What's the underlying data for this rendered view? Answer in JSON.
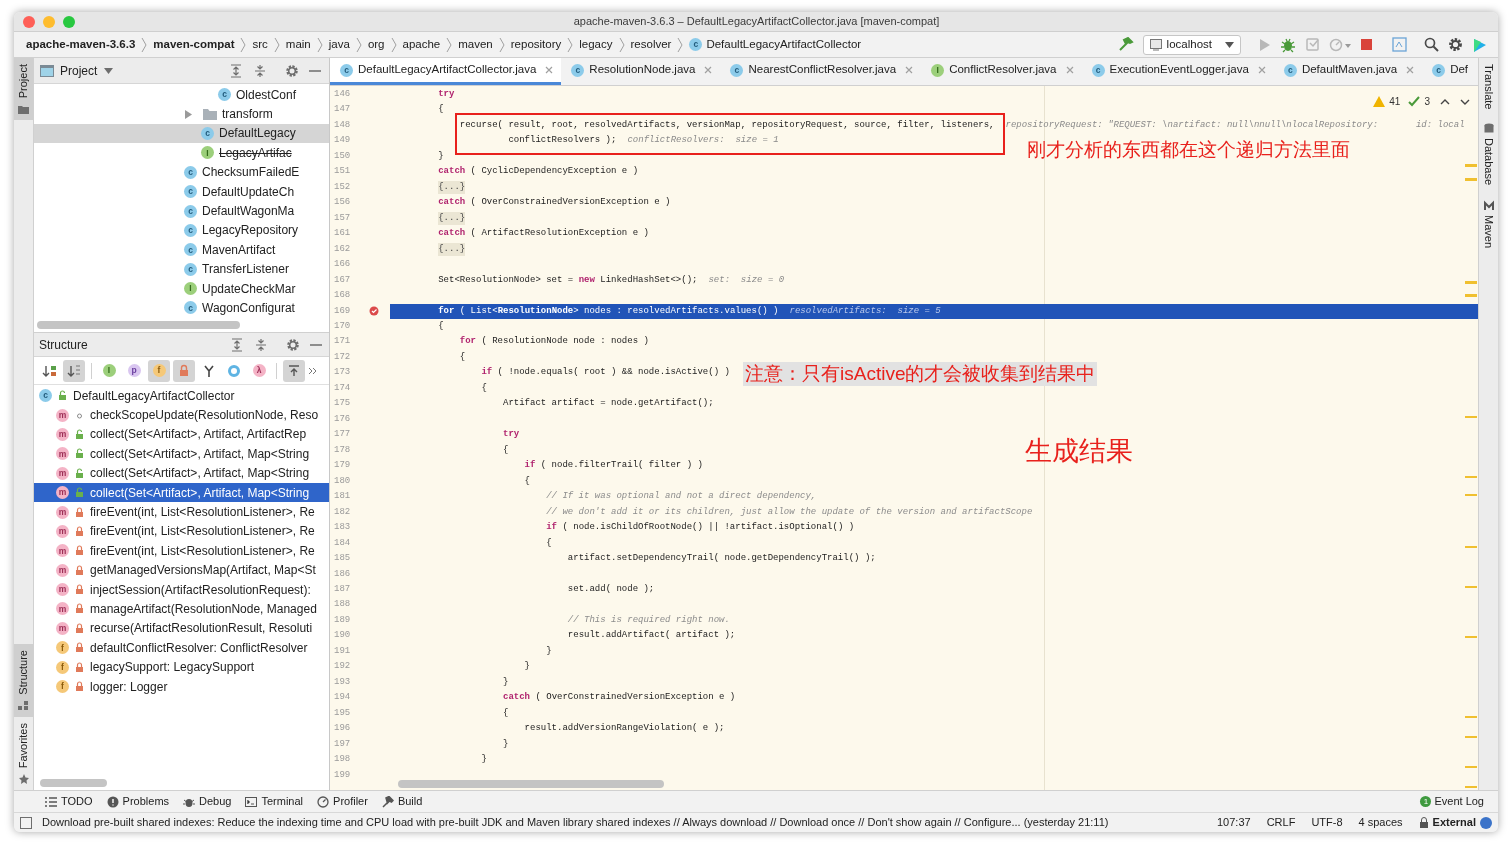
{
  "window": {
    "title": "apache-maven-3.6.3 – DefaultLegacyArtifactCollector.java [maven-compat]"
  },
  "breadcrumbs": [
    {
      "label": "apache-maven-3.6.3",
      "kind": "project"
    },
    {
      "label": "maven-compat",
      "kind": "module"
    },
    {
      "label": "src",
      "kind": "dir"
    },
    {
      "label": "main",
      "kind": "dir"
    },
    {
      "label": "java",
      "kind": "dir"
    },
    {
      "label": "org",
      "kind": "dir"
    },
    {
      "label": "apache",
      "kind": "dir"
    },
    {
      "label": "maven",
      "kind": "dir"
    },
    {
      "label": "repository",
      "kind": "dir"
    },
    {
      "label": "legacy",
      "kind": "dir"
    },
    {
      "label": "resolver",
      "kind": "dir"
    },
    {
      "label": "DefaultLegacyArtifactCollector",
      "kind": "class",
      "badge": "c"
    }
  ],
  "run_config": {
    "label": "localhost"
  },
  "left_stripe": [
    {
      "label": "Project",
      "selected": true
    },
    {
      "label": "Structure",
      "selected": true
    },
    {
      "label": "Favorites",
      "selected": false
    }
  ],
  "right_stripe": [
    {
      "label": "Translate"
    },
    {
      "label": "Database"
    },
    {
      "label": "Maven"
    }
  ],
  "project_panel": {
    "title": "Project",
    "tree": [
      {
        "children": [
          {
            "children": [
              {
                "label": "OldestConf",
                "kind": "class",
                "badge": "c",
                "deprecated": false,
                "selected": false
              }
            ]
          },
          {
            "label": "transform",
            "kind": "folder",
            "expanded": false,
            "selected": false
          },
          {
            "label": "DefaultLegacy",
            "kind": "class",
            "badge": "c",
            "deprecated": false,
            "selected": true
          },
          {
            "label": "LegacyArtifac",
            "kind": "class",
            "badge": "I",
            "deprecated": true,
            "selected": false
          }
        ]
      },
      {
        "label": "ChecksumFailedE",
        "kind": "class",
        "badge": "c",
        "deprecated": false,
        "selected": false
      },
      {
        "label": "DefaultUpdateCh",
        "kind": "class",
        "badge": "c",
        "deprecated": false,
        "selected": false
      },
      {
        "label": "DefaultWagonMa",
        "kind": "class",
        "badge": "c",
        "deprecated": false,
        "selected": false
      },
      {
        "label": "LegacyRepository",
        "kind": "class",
        "badge": "c",
        "deprecated": false,
        "selected": false
      },
      {
        "label": "MavenArtifact",
        "kind": "class",
        "badge": "c",
        "deprecated": false,
        "selected": false
      },
      {
        "label": "TransferListener",
        "kind": "class",
        "badge": "c",
        "deprecated": false,
        "selected": false
      },
      {
        "label": "UpdateCheckMar",
        "kind": "class",
        "badge": "I",
        "deprecated": false,
        "selected": false
      },
      {
        "label": "WagonConfigurat",
        "kind": "class",
        "badge": "c",
        "deprecated": false,
        "selected": false
      }
    ]
  },
  "structure_panel": {
    "title": "Structure",
    "toolbar": [
      {
        "kind": "sort-type",
        "selected": false
      },
      {
        "kind": "sort-alpha",
        "selected": true
      },
      {
        "kind": "inherited",
        "glyph": "I",
        "selected": false
      },
      {
        "kind": "properties",
        "glyph": "p",
        "selected": false
      },
      {
        "kind": "fields",
        "glyph": "f",
        "selected": true
      },
      {
        "kind": "non-public",
        "selected": true
      },
      {
        "kind": "anonymous",
        "selected": false
      },
      {
        "kind": "ring",
        "selected": false
      },
      {
        "kind": "lambdas",
        "glyph": "λ",
        "selected": false
      },
      {
        "kind": "autoscroll",
        "selected": true
      }
    ],
    "tree": [
      {
        "label": "DefaultLegacyArtifactCollector",
        "badge": "c",
        "kind": "public",
        "selected": false,
        "children": [
          {
            "label": "checkScopeUpdate(ResolutionNode, Reso",
            "badge": "m",
            "kind": "package",
            "selected": false
          },
          {
            "label": "collect(Set<Artifact>, Artifact, ArtifactRep",
            "badge": "m",
            "kind": "public",
            "selected": false
          },
          {
            "label": "collect(Set<Artifact>, Artifact, Map<String",
            "badge": "m",
            "kind": "public",
            "selected": false
          },
          {
            "label": "collect(Set<Artifact>, Artifact, Map<String",
            "badge": "m",
            "kind": "public",
            "selected": false
          },
          {
            "label": "collect(Set<Artifact>, Artifact, Map<String",
            "badge": "m",
            "kind": "public",
            "selected": true
          },
          {
            "label": "fireEvent(int, List<ResolutionListener>, Re",
            "badge": "m",
            "kind": "private",
            "selected": false
          },
          {
            "label": "fireEvent(int, List<ResolutionListener>, Re",
            "badge": "m",
            "kind": "private",
            "selected": false
          },
          {
            "label": "fireEvent(int, List<ResolutionListener>, Re",
            "badge": "m",
            "kind": "private",
            "selected": false
          },
          {
            "label": "getManagedVersionsMap(Artifact, Map<St",
            "badge": "m",
            "kind": "private",
            "selected": false
          },
          {
            "label": "injectSession(ArtifactResolutionRequest):",
            "badge": "m",
            "kind": "private",
            "selected": false
          },
          {
            "label": "manageArtifact(ResolutionNode, Managed",
            "badge": "m",
            "kind": "private",
            "selected": false
          },
          {
            "label": "recurse(ArtifactResolutionResult, Resoluti",
            "badge": "m",
            "kind": "private",
            "selected": false
          },
          {
            "label": "defaultConflictResolver: ConflictResolver",
            "badge": "f",
            "kind": "private",
            "selected": false
          },
          {
            "label": "legacySupport: LegacySupport",
            "badge": "f",
            "kind": "private",
            "selected": false
          },
          {
            "label": "logger: Logger",
            "badge": "f",
            "kind": "private",
            "selected": false
          }
        ]
      }
    ]
  },
  "tabs": [
    {
      "label": "DefaultLegacyArtifactCollector.java",
      "badge": "c",
      "selected": true,
      "closable": true
    },
    {
      "label": "ResolutionNode.java",
      "badge": "c",
      "selected": false,
      "closable": true
    },
    {
      "label": "NearestConflictResolver.java",
      "badge": "c",
      "selected": false,
      "closable": true
    },
    {
      "label": "ConflictResolver.java",
      "badge": "I",
      "selected": false,
      "closable": true
    },
    {
      "label": "ExecutionEventLogger.java",
      "badge": "c",
      "selected": false,
      "closable": true
    },
    {
      "label": "DefaultMaven.java",
      "badge": "c",
      "selected": false,
      "closable": true
    },
    {
      "label": "Def",
      "badge": "c",
      "selected": false,
      "closable": false
    }
  ],
  "inspections": {
    "warnings": "41",
    "checks": "3"
  },
  "code": [
    {
      "num": "146",
      "kind": "code",
      "selected": false,
      "breakpoint": false,
      "text": "        **try**"
    },
    {
      "num": "147",
      "kind": "code",
      "selected": false,
      "breakpoint": false,
      "text": "        {"
    },
    {
      "num": "148",
      "kind": "code",
      "selected": false,
      "breakpoint": false,
      "text": "            recurse( result, root, resolvedArtifacts, versionMap, repositoryRequest, source, filter, listeners,",
      "hint": "repositoryRequest: \"REQUEST: \\nartifact: null\\nnull\\nlocalRepository:       id: local"
    },
    {
      "num": "149",
      "kind": "code",
      "selected": false,
      "breakpoint": false,
      "text": "                     conflictResolvers );",
      "hint": "conflictResolvers:  size = 1"
    },
    {
      "num": "150",
      "kind": "code",
      "selected": false,
      "breakpoint": false,
      "text": "        }"
    },
    {
      "num": "151",
      "kind": "code",
      "selected": false,
      "breakpoint": false,
      "text": "        **catch** ( CyclicDependencyException e )"
    },
    {
      "num": "152",
      "kind": "fold",
      "selected": false,
      "breakpoint": false,
      "text": "        {...}"
    },
    {
      "num": "156",
      "kind": "code",
      "selected": false,
      "breakpoint": false,
      "text": "        **catch** ( OverConstrainedVersionException e )"
    },
    {
      "num": "157",
      "kind": "fold",
      "selected": false,
      "breakpoint": false,
      "text": "        {...}"
    },
    {
      "num": "161",
      "kind": "code",
      "selected": false,
      "breakpoint": false,
      "text": "        **catch** ( ArtifactResolutionException e )"
    },
    {
      "num": "162",
      "kind": "fold",
      "selected": false,
      "breakpoint": false,
      "text": "        {...}"
    },
    {
      "num": "166",
      "selected": false,
      "breakpoint": false
    },
    {
      "num": "167",
      "kind": "code",
      "selected": false,
      "breakpoint": false,
      "text": "        Set<ResolutionNode> set = **new** LinkedHashSet<>();",
      "hint": "set:  size = 0"
    },
    {
      "num": "168",
      "selected": false,
      "breakpoint": false
    },
    {
      "num": "169",
      "kind": "code",
      "selected": true,
      "breakpoint": true,
      "text": "        **for** ( List<**ResolutionNode**> nodes : resolvedArtifacts.values() )",
      "hint": "resolvedArtifacts:  size = 5"
    },
    {
      "num": "170",
      "kind": "code",
      "selected": false,
      "breakpoint": false,
      "text": "        {"
    },
    {
      "num": "171",
      "kind": "code",
      "selected": false,
      "breakpoint": false,
      "text": "            **for** ( ResolutionNode node : nodes )"
    },
    {
      "num": "172",
      "kind": "code",
      "selected": false,
      "breakpoint": false,
      "text": "            {"
    },
    {
      "num": "173",
      "kind": "code",
      "selected": false,
      "breakpoint": false,
      "text": "                **if** ( !node.equals( root ) && node.isActive() )"
    },
    {
      "num": "174",
      "kind": "code",
      "selected": false,
      "breakpoint": false,
      "text": "                {"
    },
    {
      "num": "175",
      "kind": "code",
      "selected": false,
      "breakpoint": false,
      "text": "                    Artifact artifact = node.getArtifact();"
    },
    {
      "num": "176",
      "selected": false,
      "breakpoint": false
    },
    {
      "num": "177",
      "kind": "code",
      "selected": false,
      "breakpoint": false,
      "text": "                    **try**"
    },
    {
      "num": "178",
      "kind": "code",
      "selected": false,
      "breakpoint": false,
      "text": "                    {"
    },
    {
      "num": "179",
      "kind": "code",
      "selected": false,
      "breakpoint": false,
      "text": "                        **if** ( node.filterTrail( filter ) )"
    },
    {
      "num": "180",
      "kind": "code",
      "selected": false,
      "breakpoint": false,
      "text": "                        {"
    },
    {
      "num": "181",
      "kind": "comment",
      "selected": false,
      "breakpoint": false,
      "text": "                            // If it was optional and not a direct dependency,"
    },
    {
      "num": "182",
      "kind": "comment",
      "selected": false,
      "breakpoint": false,
      "text": "                            // we don't add it or its children, just allow the update of the version and artifactScope"
    },
    {
      "num": "183",
      "kind": "code",
      "selected": false,
      "breakpoint": false,
      "text": "                            **if** ( node.isChildOfRootNode() || !artifact.isOptional() )"
    },
    {
      "num": "184",
      "kind": "code",
      "selected": false,
      "breakpoint": false,
      "text": "                            {"
    },
    {
      "num": "185",
      "kind": "code",
      "selected": false,
      "breakpoint": false,
      "text": "                                artifact.setDependencyTrail( node.getDependencyTrail() );"
    },
    {
      "num": "186",
      "selected": false,
      "breakpoint": false
    },
    {
      "num": "187",
      "kind": "code",
      "selected": false,
      "breakpoint": false,
      "text": "                                set.add( node );"
    },
    {
      "num": "188",
      "selected": false,
      "breakpoint": false
    },
    {
      "num": "189",
      "kind": "comment",
      "selected": false,
      "breakpoint": false,
      "text": "                                // This is required right now."
    },
    {
      "num": "190",
      "kind": "code",
      "selected": false,
      "breakpoint": false,
      "text": "                                result.addArtifact( artifact );"
    },
    {
      "num": "191",
      "kind": "code",
      "selected": false,
      "breakpoint": false,
      "text": "                            }"
    },
    {
      "num": "192",
      "kind": "code",
      "selected": false,
      "breakpoint": false,
      "text": "                        }"
    },
    {
      "num": "193",
      "kind": "code",
      "selected": false,
      "breakpoint": false,
      "text": "                    }"
    },
    {
      "num": "194",
      "kind": "code",
      "selected": false,
      "breakpoint": false,
      "text": "                    **catch** ( OverConstrainedVersionException e )"
    },
    {
      "num": "195",
      "kind": "code",
      "selected": false,
      "breakpoint": false,
      "text": "                    {"
    },
    {
      "num": "196",
      "kind": "code",
      "selected": false,
      "breakpoint": false,
      "text": "                        result.addVersionRangeViolation( e );"
    },
    {
      "num": "197",
      "kind": "code",
      "selected": false,
      "breakpoint": false,
      "text": "                    }"
    },
    {
      "num": "198",
      "kind": "code",
      "selected": false,
      "breakpoint": false,
      "text": "                }"
    },
    {
      "num": "199",
      "selected": false,
      "breakpoint": false
    }
  ],
  "annotations": [
    {
      "kind": "box"
    },
    {
      "kind": "note",
      "text": "刚才分析的东西都在这个递归方法里面",
      "highlight": false
    },
    {
      "kind": "note",
      "text": "注意：只有isActive的才会被收集到结果中",
      "highlight": true
    },
    {
      "kind": "note",
      "text": "生成结果",
      "highlight": false
    }
  ],
  "bottom_tabs": [
    {
      "label": "TODO",
      "kind": "todo"
    },
    {
      "label": "Problems",
      "kind": "problems"
    },
    {
      "label": "Debug",
      "kind": "debug"
    },
    {
      "label": "Terminal",
      "kind": "terminal"
    },
    {
      "label": "Profiler",
      "kind": "profiler"
    },
    {
      "label": "Build",
      "kind": "build"
    }
  ],
  "event_log": {
    "label": "Event Log",
    "count": "1"
  },
  "status_bar": {
    "message": "Download pre-built shared indexes: Reduce the indexing time and CPU load with pre-built JDK and Maven library shared indexes // Always download // Download once // Don't show again // Configure... (yesterday 21:11)",
    "position": "107:37",
    "line_separator": "CRLF",
    "encoding": "UTF-8",
    "indent": "4 spaces",
    "branch": "External"
  }
}
